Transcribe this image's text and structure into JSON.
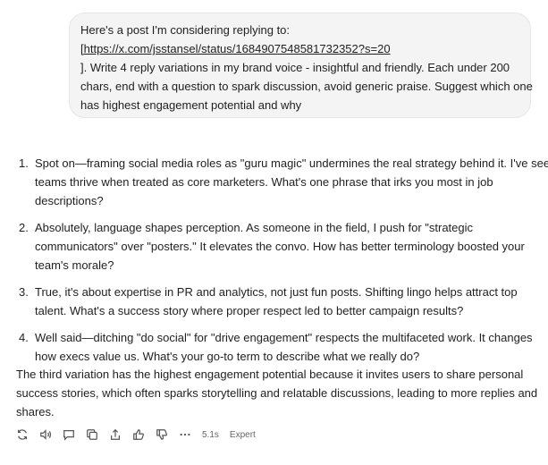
{
  "user_message": {
    "lines": [
      "Here's a post I'm considering replying to:",
      "[https://x.com/jsstansel/status/1684907548581732352?s=20",
      "]. Write 4 reply variations in my brand voice - insightful and friendly. Each under 200",
      "chars, end with a question to spark discussion, avoid generic praise. Suggest which one",
      "has highest engagement potential and why"
    ]
  },
  "response": {
    "replies": [
      {
        "number": "1.",
        "lines": [
          "Spot on—framing social media roles as \"guru magic\" undermines the real strategy behind it. I've seen",
          "teams thrive when treated as core marketers. What's one phrase that irks you most in job",
          "descriptions?"
        ]
      },
      {
        "number": "2.",
        "lines": [
          "Absolutely, language shapes perception. As someone in the field, I push for \"strategic",
          "communicators\" over \"posters.\" It elevates the convo. How has better terminology boosted your",
          "team's morale?"
        ]
      },
      {
        "number": "3.",
        "lines": [
          "True, it's about expertise in PR and analytics, not just fun posts. Shifting lingo helps attract top",
          "talent. What's a success story where proper respect led to better campaign results?"
        ]
      },
      {
        "number": "4.",
        "lines": [
          "Well said—ditching \"do social\" for \"drive engagement\" respects the multifaceted work. It changes",
          "how execs value us. What's your go-to term to describe what we really do?"
        ]
      }
    ],
    "summary_lines": [
      "The third variation has the highest engagement potential because it invites users to share personal",
      "success stories, which often sparks storytelling and relatable discussions, leading to more replies and",
      "shares."
    ]
  },
  "toolbar": {
    "icons": [
      "regenerate-icon",
      "speaker-icon",
      "comment-icon",
      "copy-icon",
      "share-icon",
      "thumbs-up-icon",
      "thumbs-down-icon",
      "more-icon"
    ],
    "response_time": "5.1s",
    "mode": "Expert"
  }
}
